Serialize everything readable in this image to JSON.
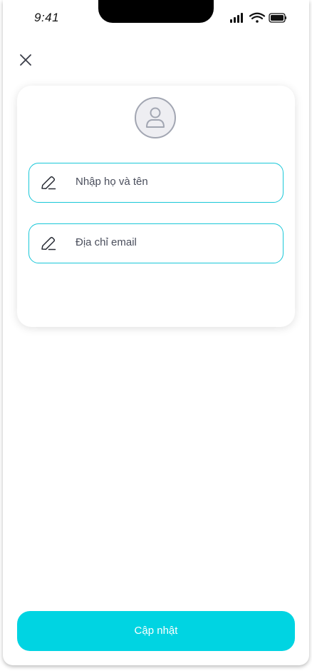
{
  "status_bar": {
    "time": "9:41",
    "icons": [
      "signal-icon",
      "wifi-icon",
      "battery-icon"
    ]
  },
  "header": {
    "close_icon": "close-icon"
  },
  "profile": {
    "avatar_icon": "user-icon",
    "name_field": {
      "placeholder": "Nhập họ và tên",
      "icon": "pencil-icon"
    },
    "email_field": {
      "placeholder": "Địa chỉ email",
      "icon": "pencil-icon"
    }
  },
  "actions": {
    "submit_label": "Cập nhật"
  },
  "colors": {
    "accent": "#00d4e2",
    "field_border": "#19c7d8",
    "avatar_stroke": "#a2a6b2"
  }
}
